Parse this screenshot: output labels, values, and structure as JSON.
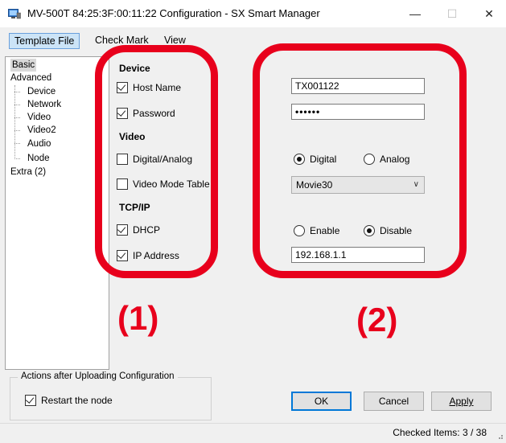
{
  "window": {
    "title": "MV-500T 84:25:3F:00:11:22  Configuration - SX Smart Manager",
    "minimize": "—",
    "maximize": "☐",
    "close": "✕"
  },
  "menu": {
    "items": [
      "Template File",
      "Check Mark",
      "View"
    ]
  },
  "tree": {
    "items": [
      "Basic",
      "Advanced",
      "Device",
      "Network",
      "Video",
      "Video2",
      "Audio",
      "Node",
      "Extra (2)"
    ]
  },
  "left_panel": {
    "section_device": "Device",
    "host_name": "Host Name",
    "host_name_checked": true,
    "password": "Password",
    "password_checked": true,
    "section_video": "Video",
    "digital_analog": "Digital/Analog",
    "digital_analog_checked": false,
    "video_mode_table": "Video Mode Table",
    "video_mode_table_checked": false,
    "section_tcpip": "TCP/IP",
    "dhcp": "DHCP",
    "dhcp_checked": true,
    "ip_address": "IP Address",
    "ip_address_checked": true
  },
  "right_panel": {
    "host_name_value": "TX001122",
    "password_value": "••••••",
    "video_digital": "Digital",
    "video_analog": "Analog",
    "video_selected": "Digital",
    "video_mode_value": "Movie30",
    "dhcp_enable": "Enable",
    "dhcp_disable": "Disable",
    "dhcp_selected": "Disable",
    "ip_value": "192.168.1.1"
  },
  "annotations": {
    "label1": "(1)",
    "label2": "(2)",
    "accent_color": "#e8001c"
  },
  "actions": {
    "group_title": "Actions after Uploading Configuration",
    "restart_label": "Restart the node",
    "restart_checked": true
  },
  "buttons": {
    "ok": "OK",
    "cancel": "Cancel",
    "apply": "Apply"
  },
  "status": {
    "checked_items": "Checked Items: 3 / 38"
  }
}
